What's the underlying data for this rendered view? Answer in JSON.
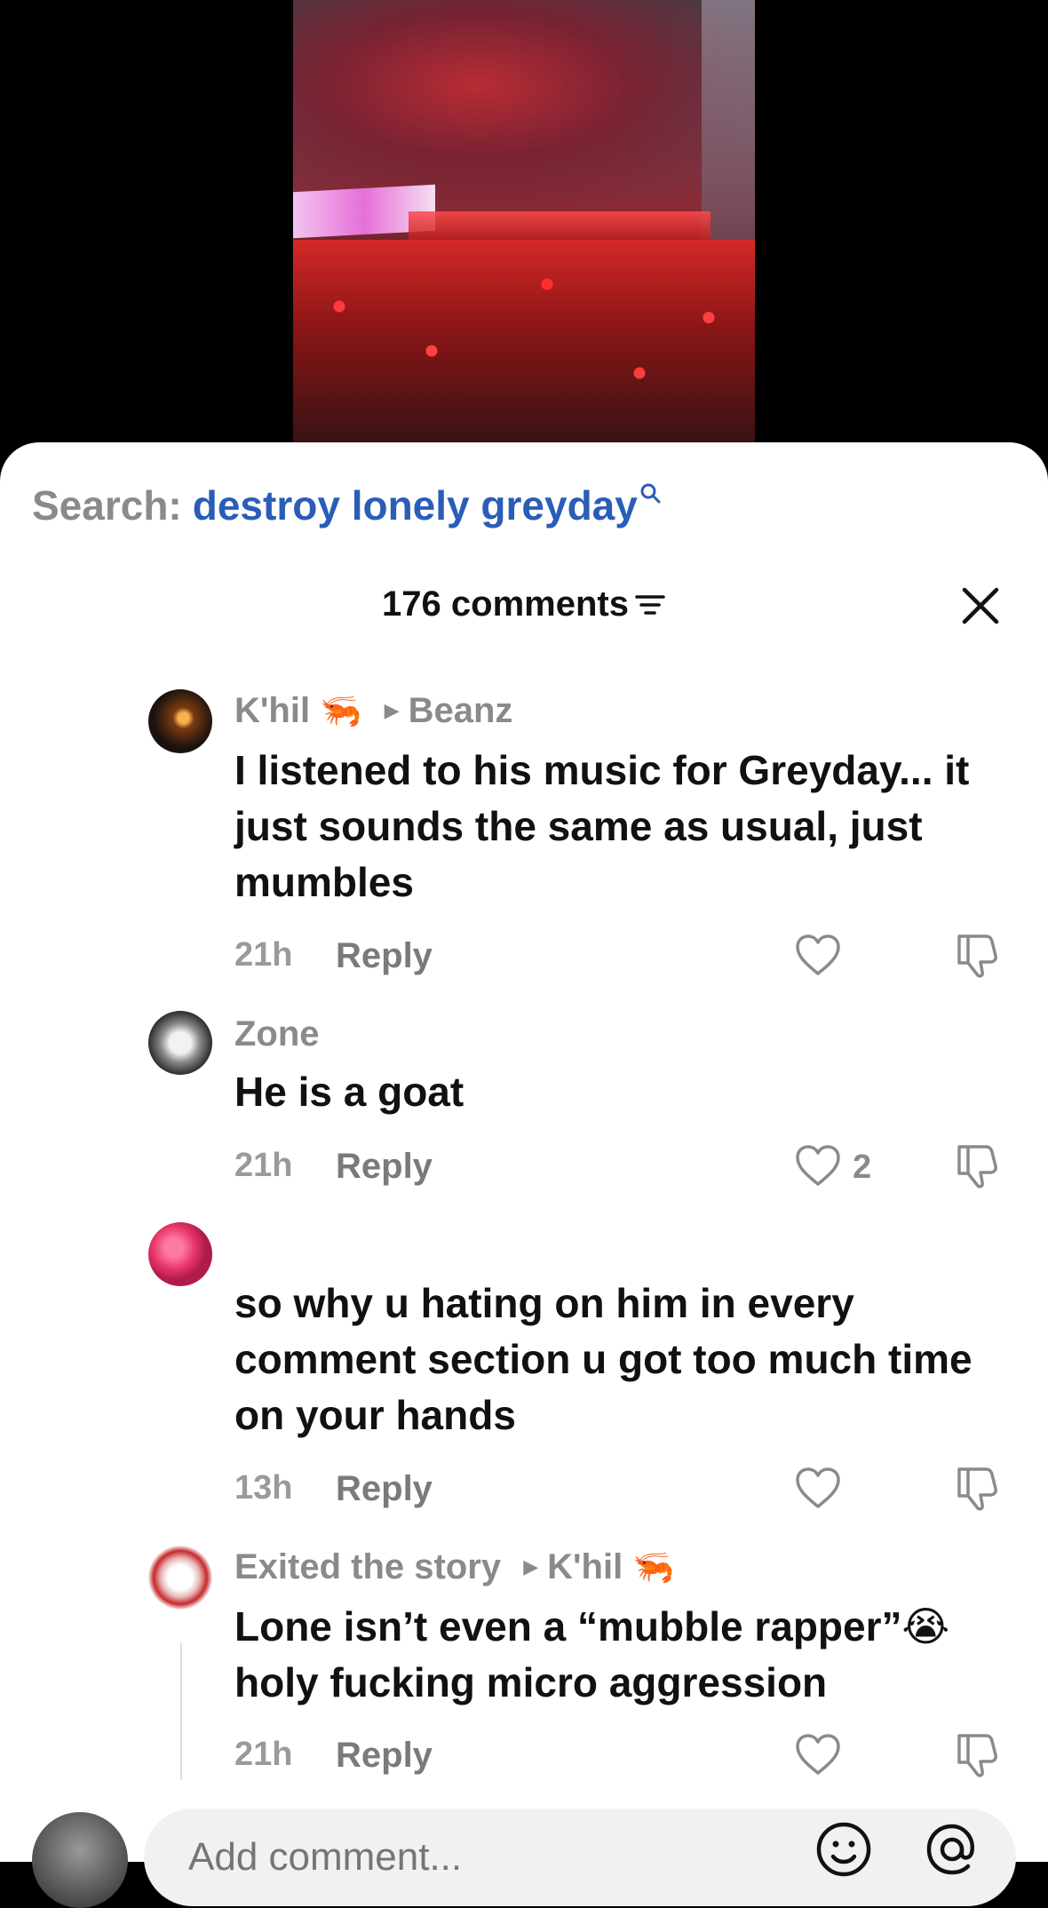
{
  "search": {
    "prefix": "Search:",
    "term": "destroy lonely greyday"
  },
  "header": {
    "count_label": "176 comments"
  },
  "comments": [
    {
      "author": "K'hil",
      "author_emoji": "🦐",
      "reply_to": "Beanz",
      "text": "I listened to his music for Greyday... it just sounds the same as usual, just mumbles",
      "time": "21h",
      "reply_label": "Reply",
      "likes": ""
    },
    {
      "author": "Zone",
      "text": "He is a goat",
      "time": "21h",
      "reply_label": "Reply",
      "likes": "2"
    },
    {
      "author": "",
      "text": "so why u hating on him in every comment section u got too much time on your hands",
      "time": "13h",
      "reply_label": "Reply",
      "likes": ""
    },
    {
      "author": "Exited the story",
      "reply_to": "K'hil",
      "reply_to_emoji": "🦐",
      "text": "Lone isn’t even a “mubble rapper”😭 holy fucking micro aggression",
      "time": "21h",
      "reply_label": "Reply",
      "likes": ""
    }
  ],
  "composer": {
    "placeholder": "Add comment..."
  },
  "colors": {
    "search_term": "#2a5db8",
    "meta_text": "#8a8a8a",
    "body_text": "#111111"
  }
}
